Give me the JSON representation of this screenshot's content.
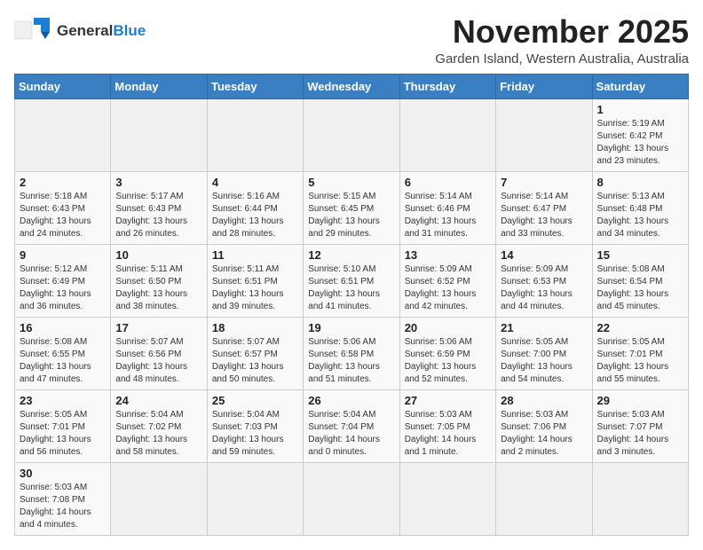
{
  "header": {
    "logo_general": "General",
    "logo_blue": "Blue",
    "month_title": "November 2025",
    "subtitle": "Garden Island, Western Australia, Australia"
  },
  "days_of_week": [
    "Sunday",
    "Monday",
    "Tuesday",
    "Wednesday",
    "Thursday",
    "Friday",
    "Saturday"
  ],
  "weeks": [
    [
      {
        "day": "",
        "info": ""
      },
      {
        "day": "",
        "info": ""
      },
      {
        "day": "",
        "info": ""
      },
      {
        "day": "",
        "info": ""
      },
      {
        "day": "",
        "info": ""
      },
      {
        "day": "",
        "info": ""
      },
      {
        "day": "1",
        "info": "Sunrise: 5:19 AM\nSunset: 6:42 PM\nDaylight: 13 hours\nand 23 minutes."
      }
    ],
    [
      {
        "day": "2",
        "info": "Sunrise: 5:18 AM\nSunset: 6:43 PM\nDaylight: 13 hours\nand 24 minutes."
      },
      {
        "day": "3",
        "info": "Sunrise: 5:17 AM\nSunset: 6:43 PM\nDaylight: 13 hours\nand 26 minutes."
      },
      {
        "day": "4",
        "info": "Sunrise: 5:16 AM\nSunset: 6:44 PM\nDaylight: 13 hours\nand 28 minutes."
      },
      {
        "day": "5",
        "info": "Sunrise: 5:15 AM\nSunset: 6:45 PM\nDaylight: 13 hours\nand 29 minutes."
      },
      {
        "day": "6",
        "info": "Sunrise: 5:14 AM\nSunset: 6:46 PM\nDaylight: 13 hours\nand 31 minutes."
      },
      {
        "day": "7",
        "info": "Sunrise: 5:14 AM\nSunset: 6:47 PM\nDaylight: 13 hours\nand 33 minutes."
      },
      {
        "day": "8",
        "info": "Sunrise: 5:13 AM\nSunset: 6:48 PM\nDaylight: 13 hours\nand 34 minutes."
      }
    ],
    [
      {
        "day": "9",
        "info": "Sunrise: 5:12 AM\nSunset: 6:49 PM\nDaylight: 13 hours\nand 36 minutes."
      },
      {
        "day": "10",
        "info": "Sunrise: 5:11 AM\nSunset: 6:50 PM\nDaylight: 13 hours\nand 38 minutes."
      },
      {
        "day": "11",
        "info": "Sunrise: 5:11 AM\nSunset: 6:51 PM\nDaylight: 13 hours\nand 39 minutes."
      },
      {
        "day": "12",
        "info": "Sunrise: 5:10 AM\nSunset: 6:51 PM\nDaylight: 13 hours\nand 41 minutes."
      },
      {
        "day": "13",
        "info": "Sunrise: 5:09 AM\nSunset: 6:52 PM\nDaylight: 13 hours\nand 42 minutes."
      },
      {
        "day": "14",
        "info": "Sunrise: 5:09 AM\nSunset: 6:53 PM\nDaylight: 13 hours\nand 44 minutes."
      },
      {
        "day": "15",
        "info": "Sunrise: 5:08 AM\nSunset: 6:54 PM\nDaylight: 13 hours\nand 45 minutes."
      }
    ],
    [
      {
        "day": "16",
        "info": "Sunrise: 5:08 AM\nSunset: 6:55 PM\nDaylight: 13 hours\nand 47 minutes."
      },
      {
        "day": "17",
        "info": "Sunrise: 5:07 AM\nSunset: 6:56 PM\nDaylight: 13 hours\nand 48 minutes."
      },
      {
        "day": "18",
        "info": "Sunrise: 5:07 AM\nSunset: 6:57 PM\nDaylight: 13 hours\nand 50 minutes."
      },
      {
        "day": "19",
        "info": "Sunrise: 5:06 AM\nSunset: 6:58 PM\nDaylight: 13 hours\nand 51 minutes."
      },
      {
        "day": "20",
        "info": "Sunrise: 5:06 AM\nSunset: 6:59 PM\nDaylight: 13 hours\nand 52 minutes."
      },
      {
        "day": "21",
        "info": "Sunrise: 5:05 AM\nSunset: 7:00 PM\nDaylight: 13 hours\nand 54 minutes."
      },
      {
        "day": "22",
        "info": "Sunrise: 5:05 AM\nSunset: 7:01 PM\nDaylight: 13 hours\nand 55 minutes."
      }
    ],
    [
      {
        "day": "23",
        "info": "Sunrise: 5:05 AM\nSunset: 7:01 PM\nDaylight: 13 hours\nand 56 minutes."
      },
      {
        "day": "24",
        "info": "Sunrise: 5:04 AM\nSunset: 7:02 PM\nDaylight: 13 hours\nand 58 minutes."
      },
      {
        "day": "25",
        "info": "Sunrise: 5:04 AM\nSunset: 7:03 PM\nDaylight: 13 hours\nand 59 minutes."
      },
      {
        "day": "26",
        "info": "Sunrise: 5:04 AM\nSunset: 7:04 PM\nDaylight: 14 hours\nand 0 minutes."
      },
      {
        "day": "27",
        "info": "Sunrise: 5:03 AM\nSunset: 7:05 PM\nDaylight: 14 hours\nand 1 minute."
      },
      {
        "day": "28",
        "info": "Sunrise: 5:03 AM\nSunset: 7:06 PM\nDaylight: 14 hours\nand 2 minutes."
      },
      {
        "day": "29",
        "info": "Sunrise: 5:03 AM\nSunset: 7:07 PM\nDaylight: 14 hours\nand 3 minutes."
      }
    ],
    [
      {
        "day": "30",
        "info": "Sunrise: 5:03 AM\nSunset: 7:08 PM\nDaylight: 14 hours\nand 4 minutes."
      },
      {
        "day": "",
        "info": ""
      },
      {
        "day": "",
        "info": ""
      },
      {
        "day": "",
        "info": ""
      },
      {
        "day": "",
        "info": ""
      },
      {
        "day": "",
        "info": ""
      },
      {
        "day": "",
        "info": ""
      }
    ]
  ]
}
